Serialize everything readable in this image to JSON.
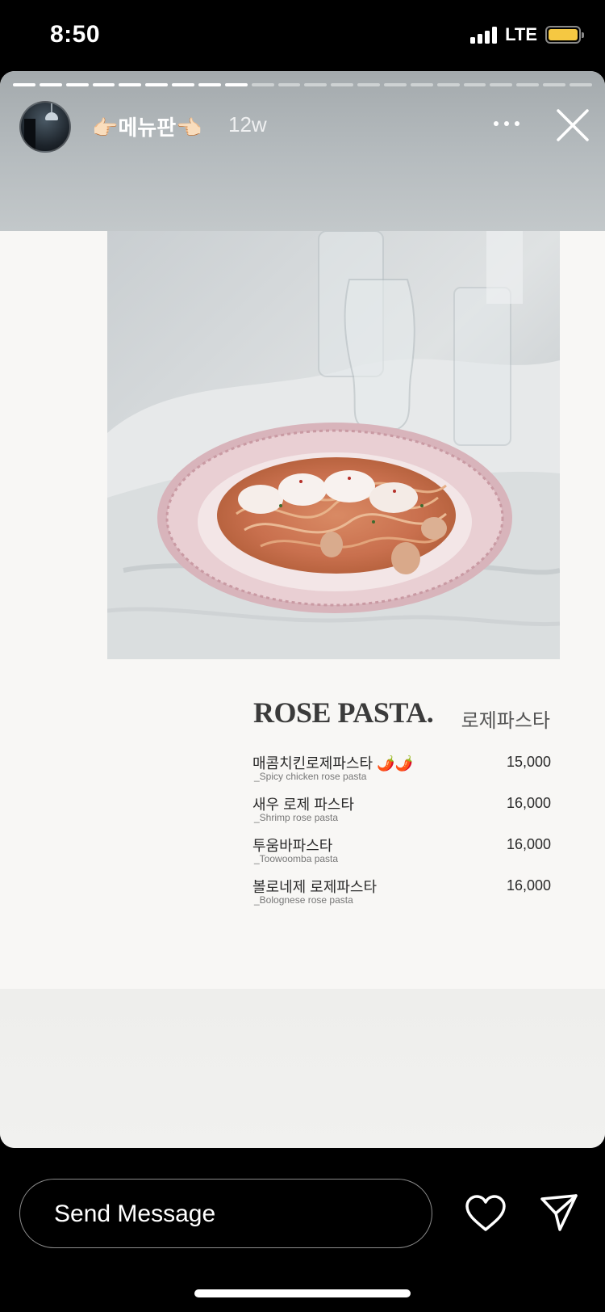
{
  "status_bar": {
    "time": "8:50",
    "network": "LTE",
    "battery_color": "#f5c842"
  },
  "story": {
    "total_segments": 22,
    "current_segment": 9,
    "user_name": "👉🏻메뉴판👈🏻",
    "time_ago": "12w",
    "more_icon": "more-horizontal-icon",
    "close_icon": "close-icon"
  },
  "menu": {
    "title": "ROSE PASTA.",
    "title_ko": "로제파스타",
    "items": [
      {
        "name": "매콤치킨로제파스타 🌶️🌶️",
        "sub": "_Spicy chicken rose pasta",
        "price": "15,000"
      },
      {
        "name": "새우 로제 파스타",
        "sub": "_Shrimp rose pasta",
        "price": "16,000"
      },
      {
        "name": "투움바파스타",
        "sub": "_Toowoomba pasta",
        "price": "16,000"
      },
      {
        "name": "볼로네제 로제파스타",
        "sub": "_Bolognese rose pasta",
        "price": "16,000"
      }
    ]
  },
  "reply": {
    "placeholder": "Send Message",
    "heart_icon": "heart-icon",
    "send_icon": "send-icon"
  }
}
